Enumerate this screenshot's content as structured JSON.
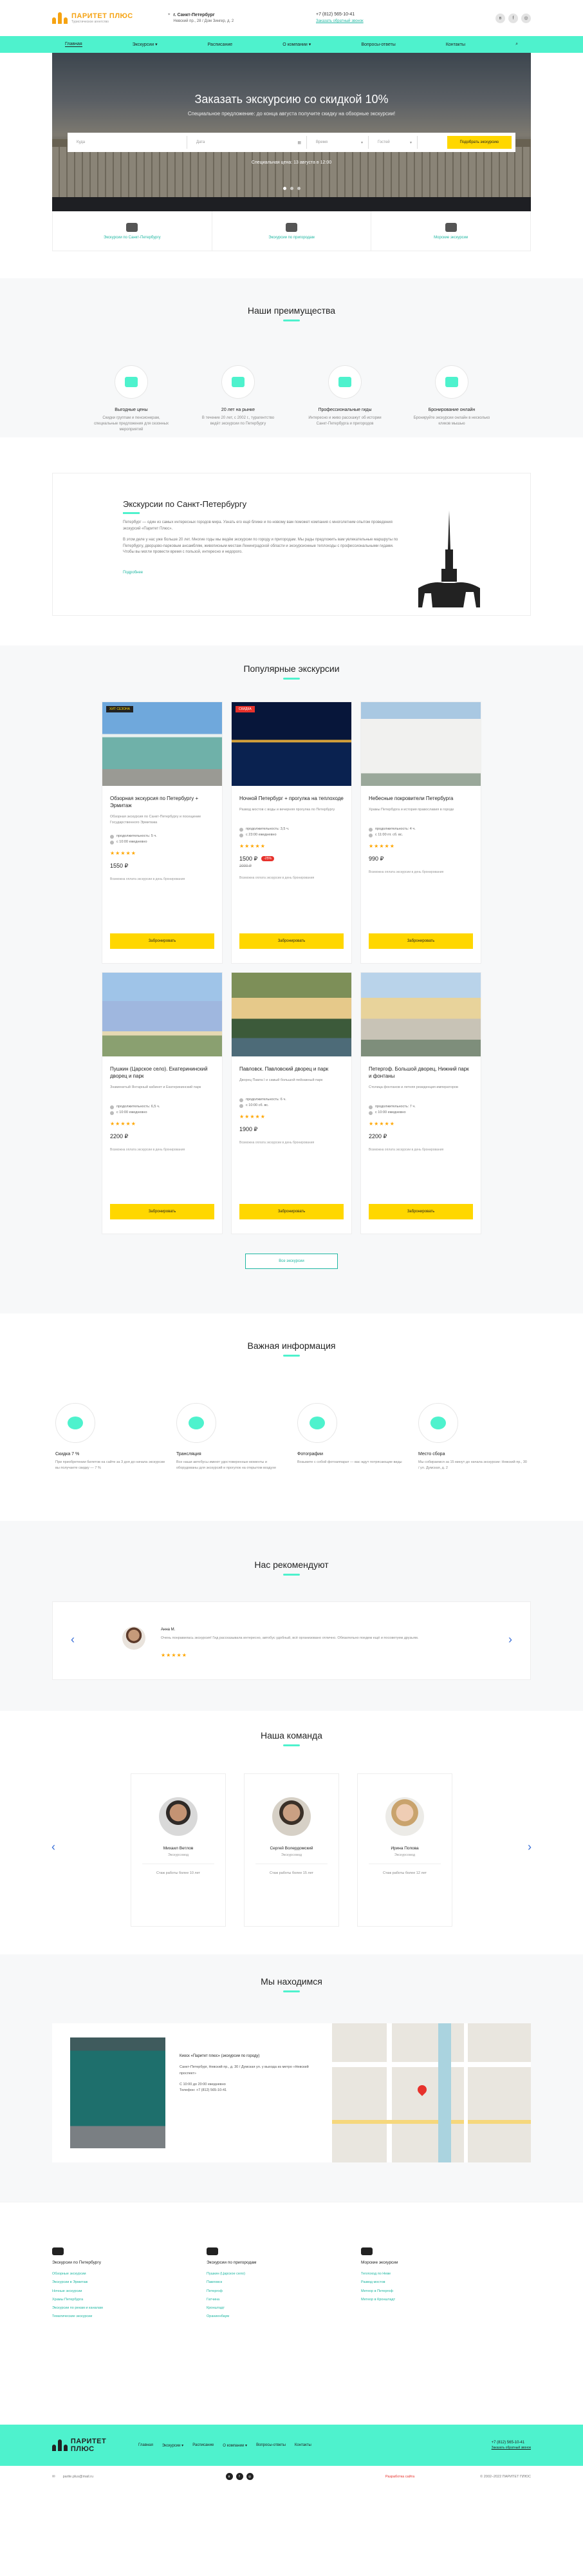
{
  "header": {
    "logo_title": "ПАРИТЕТ ПЛЮС",
    "logo_sub": "Туристическое агентство",
    "city": "г. Санкт-Петербург",
    "address": "Невский пр., 28 / Дом Зингер, д. 2",
    "phone": "+7 (812) 565-10-41",
    "callback": "Заказать обратный звонок"
  },
  "nav": [
    "Главная",
    "Экскурсии ▾",
    "Расписание",
    "О компании ▾",
    "Вопросы-ответы",
    "Контакты",
    "⌕"
  ],
  "hero": {
    "title": "Заказать экскурсию со скидкой 10%",
    "subtitle": "Специальное предложение: до конца августа получите скидку на обзорные экскурсии!",
    "f1": "Куда",
    "f2": "Дата",
    "f3": "Время",
    "f4": "Гостей",
    "button": "Подобрать экскурсию",
    "note": "Специальная цена: 13 августа в 12:00"
  },
  "features": [
    "Экскурсии по Санкт-Петербургу",
    "Экскурсии по пригородам",
    "Морские экскурсии"
  ],
  "advantages": {
    "title": "Наши преимущества",
    "items": [
      {
        "title": "Выгодные цены",
        "text": "Скидки группам и пенсионерам, специальные предложения для сезонных мероприятий"
      },
      {
        "title": "20 лет на рынке",
        "text": "В течение 20 лет, с 2002 г., турагентство ведёт экскурсии по Петербургу"
      },
      {
        "title": "Профессиональные гиды",
        "text": "Интересно и живо расскажут об истории Санкт-Петербурга и пригородов"
      },
      {
        "title": "Бронирование онлайн",
        "text": "Бронируйте экскурсии онлайн в несколько кликов мышью"
      }
    ]
  },
  "about": {
    "title": "Экскурсии по Санкт-Петербургу",
    "p1": "Петербург — один из самых интересных городов мира. Узнать его ещё ближе и по-новому вам поможет компания с многолетним опытом проведения экскурсий «Паритет Плюс».",
    "p2": "В этом деле у нас уже больше 20 лет. Многие годы мы ведём экскурсии по городу и пригородам. Мы рады предложить вам увлекательные маршруты по Петербургу, дворцово-парковым ансамблям, живописным местам Ленинградской области и экскурсионные теплоходы с профессиональными гидами. Чтобы вы могли провести время с пользой, интересно и недорого.",
    "more": "Подробнее"
  },
  "popular": {
    "title": "Популярные экскурсии",
    "all": "Все экскурсии",
    "cards": [
      {
        "badge": "ХИТ СЕЗОНА",
        "title": "Обзорная экскурсия по Петербургу + Эрмитаж",
        "desc": "Обзорная экскурсия по Санкт-Петербургу и посещение Государственного Эрмитажа",
        "dur": "продолжительность: 5 ч.",
        "date": "с 10:00 ежедневно",
        "stars": "★★★★★",
        "price": "1550 ₽",
        "old": "",
        "sale": "",
        "note": "Возможна оплата экскурсии в день бронирования",
        "btn": "Забронировать"
      },
      {
        "badge": "СКИДКА",
        "title": "Ночной Петербург + прогулка на теплоходе",
        "desc": "Развод мостов с воды и вечерняя прогулка по Петербургу",
        "dur": "продолжительность: 3,5 ч.",
        "date": "с 23:00 ежедневно",
        "stars": "★★★★★",
        "price": "1500 ₽",
        "old": "2000 ₽",
        "sale": "-25%",
        "note": "Возможна оплата экскурсии в день бронирования",
        "btn": "Забронировать"
      },
      {
        "badge": "",
        "title": "Небесные покровители Петербурга",
        "desc": "Храмы Петербурга и история православия в городе",
        "dur": "продолжительность: 4 ч.",
        "date": "с 11:00 пт. сб. вс.",
        "stars": "★★★★★",
        "price": "990 ₽",
        "old": "",
        "sale": "",
        "note": "Возможна оплата экскурсии в день бронирования",
        "btn": "Забронировать"
      },
      {
        "badge": "",
        "title": "Пушкин (Царское село). Екатерининский дворец и парк",
        "desc": "Знаменитый Янтарный кабинет и Екатерининский парк",
        "dur": "продолжительность: 6,5 ч.",
        "date": "с 10:00 ежедневно",
        "stars": "★★★★★",
        "price": "2200 ₽",
        "old": "",
        "sale": "",
        "note": "Возможна оплата экскурсии в день бронирования",
        "btn": "Забронировать"
      },
      {
        "badge": "",
        "title": "Павловск. Павловский дворец и парк",
        "desc": "Дворец Павла I и самый большой пейзажный парк",
        "dur": "продолжительность: 6 ч.",
        "date": "с 10:00 сб. вс.",
        "stars": "★★★★★",
        "price": "1900 ₽",
        "old": "",
        "sale": "",
        "note": "Возможна оплата экскурсии в день бронирования",
        "btn": "Забронировать"
      },
      {
        "badge": "",
        "title": "Петергоф. Большой дворец, Нижний парк и фонтаны",
        "desc": "Столица фонтанов и летняя резиденция императоров",
        "dur": "продолжительность: 7 ч.",
        "date": "с 10:00 ежедневно",
        "stars": "★★★★★",
        "price": "2200 ₽",
        "old": "",
        "sale": "",
        "note": "Возможна оплата экскурсии в день бронирования",
        "btn": "Забронировать"
      }
    ]
  },
  "info": {
    "title": "Важная информация",
    "items": [
      {
        "title": "Скидка 7 %",
        "text": "При приобретении билетов на сайте за 3 дня до начала экскурсии вы получаете скидку — 7 %"
      },
      {
        "title": "Трансляция",
        "text": "Все наши автобусы имеют удостоверенные моменты и оборудованы для экскурсий и прогулок на открытом воздухе"
      },
      {
        "title": "Фотографии",
        "text": "Возьмите с собой фотоаппарат — вас ждут потрясающие виды"
      },
      {
        "title": "Место сбора",
        "text": "Мы собираемся за 15 минут до начала экскурсии: Невский пр., 30 / ул. Думская, д. 2"
      }
    ]
  },
  "reviews": {
    "title": "Нас рекомендуют",
    "name": "Анна М.",
    "text": "Очень понравилась экскурсия! Гид рассказывала интересно, автобус удобный, всё организовано отлично. Обязательно поедем ещё и посоветуем друзьям.",
    "stars": "★★★★★"
  },
  "team": {
    "title": "Наша команда",
    "members": [
      {
        "name": "Михаил Ветлов",
        "role": "Экскурсовод",
        "text": "Стаж работы более 10 лет"
      },
      {
        "name": "Сергей Волердомский",
        "role": "Экскурсовод",
        "text": "Стаж работы более 15 лет"
      },
      {
        "name": "Ирина Попова",
        "role": "Экскурсовод",
        "text": "Стаж работы более 12 лет"
      }
    ]
  },
  "location": {
    "title": "Мы находимся",
    "name": "Киоск «Паритет плюс» (экскурсии по городу)",
    "text": "Санкт-Петербург, Невский пр., д. 30 / Думская ул. у выхода из метро «Невский проспект»",
    "hours1": "С 10:00 до 20:00 ежедневно",
    "hours2": "Телефон: +7 (812) 565-10-41"
  },
  "footer": {
    "cols": [
      {
        "title": "Экскурсии по Петербургу",
        "links": [
          "Обзорные экскурсии",
          "Экскурсии в Эрмитаж",
          "Ночные экскурсии",
          "Храмы Петербурга",
          "Экскурсии по рекам и каналам",
          "Тематические экскурсии"
        ]
      },
      {
        "title": "Экскурсии по пригородам",
        "links": [
          "Пушкин (Царское село)",
          "Павловск",
          "Петергоф",
          "Гатчина",
          "Кронштадт",
          "Ораниенбаум"
        ]
      },
      {
        "title": "Морские экскурсии",
        "links": [
          "Теплоход по Неве",
          "Развод мостов",
          "Метеор в Петергоф",
          "Метеор в Кронштадт"
        ]
      }
    ],
    "nav": [
      "Главная",
      "Экскурсии ▾",
      "Расписание",
      "О компании ▾",
      "Вопросы-ответы",
      "Контакты"
    ],
    "phone": "+7 (812) 565-10-41",
    "callback": "Заказать обратный звонок",
    "email": "parite.plus@mail.ru",
    "made": "Разработка сайта",
    "copy": "© 2002–2022 ПАРИТЕТ ПЛЮС"
  }
}
